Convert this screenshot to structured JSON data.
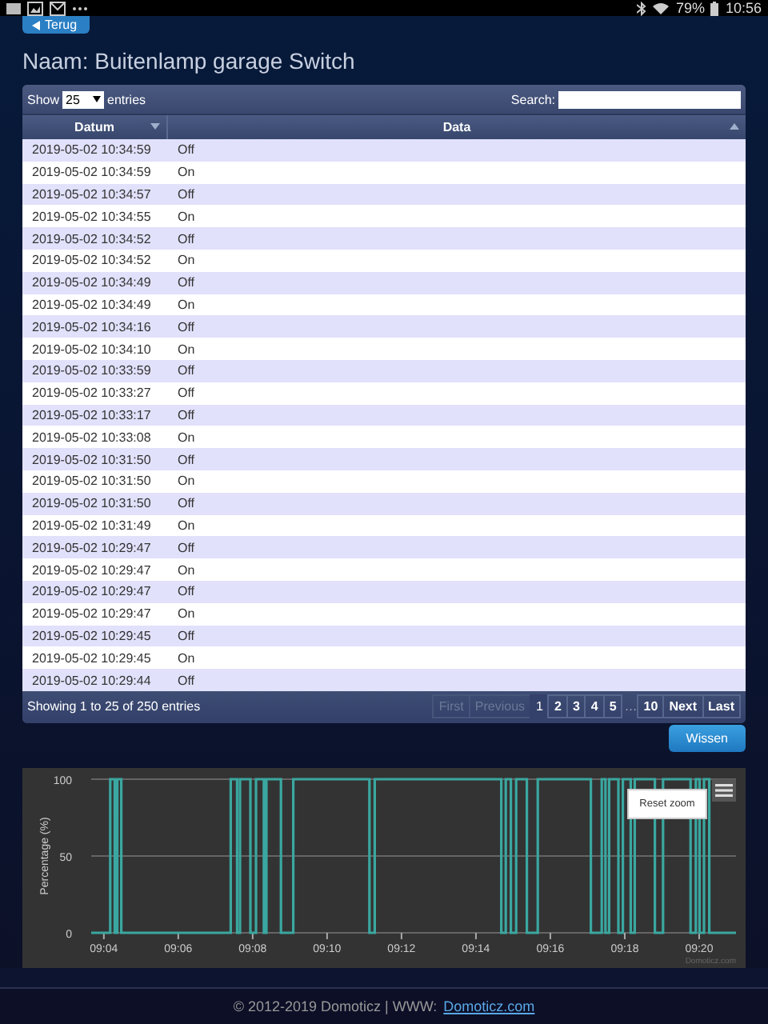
{
  "status_bar": {
    "battery": "79%",
    "time": "10:56"
  },
  "back_button": {
    "label": "Terug"
  },
  "title": "Naam: Buitenlamp garage Switch",
  "table": {
    "length_label_before": "Show",
    "length_value": "25",
    "length_label_after": "entries",
    "search_label": "Search:",
    "columns": [
      {
        "label": "Datum",
        "sort_ascending": false
      },
      {
        "label": "Data",
        "sort_ascending": true
      }
    ],
    "rows": [
      [
        "2019-05-02 10:34:59",
        "Off"
      ],
      [
        "2019-05-02 10:34:59",
        "On"
      ],
      [
        "2019-05-02 10:34:57",
        "Off"
      ],
      [
        "2019-05-02 10:34:55",
        "On"
      ],
      [
        "2019-05-02 10:34:52",
        "Off"
      ],
      [
        "2019-05-02 10:34:52",
        "On"
      ],
      [
        "2019-05-02 10:34:49",
        "Off"
      ],
      [
        "2019-05-02 10:34:49",
        "On"
      ],
      [
        "2019-05-02 10:34:16",
        "Off"
      ],
      [
        "2019-05-02 10:34:10",
        "On"
      ],
      [
        "2019-05-02 10:33:59",
        "Off"
      ],
      [
        "2019-05-02 10:33:27",
        "Off"
      ],
      [
        "2019-05-02 10:33:17",
        "Off"
      ],
      [
        "2019-05-02 10:33:08",
        "On"
      ],
      [
        "2019-05-02 10:31:50",
        "Off"
      ],
      [
        "2019-05-02 10:31:50",
        "On"
      ],
      [
        "2019-05-02 10:31:50",
        "Off"
      ],
      [
        "2019-05-02 10:31:49",
        "On"
      ],
      [
        "2019-05-02 10:29:47",
        "Off"
      ],
      [
        "2019-05-02 10:29:47",
        "On"
      ],
      [
        "2019-05-02 10:29:47",
        "Off"
      ],
      [
        "2019-05-02 10:29:47",
        "On"
      ],
      [
        "2019-05-02 10:29:45",
        "Off"
      ],
      [
        "2019-05-02 10:29:45",
        "On"
      ],
      [
        "2019-05-02 10:29:44",
        "Off"
      ]
    ],
    "info": "Showing 1 to 25 of 250 entries",
    "pagination": [
      {
        "label": "First",
        "kind": "button",
        "disabled": true,
        "selected": false
      },
      {
        "label": "Previous",
        "kind": "button",
        "disabled": true,
        "selected": false
      },
      {
        "label": "1",
        "kind": "number",
        "disabled": false,
        "selected": true
      },
      {
        "label": "2",
        "kind": "number",
        "disabled": false,
        "selected": false
      },
      {
        "label": "3",
        "kind": "number",
        "disabled": false,
        "selected": false
      },
      {
        "label": "4",
        "kind": "number",
        "disabled": false,
        "selected": false
      },
      {
        "label": "5",
        "kind": "number",
        "disabled": false,
        "selected": false
      },
      {
        "label": "…",
        "kind": "ellipsis"
      },
      {
        "label": "10",
        "kind": "number",
        "disabled": false,
        "selected": false
      },
      {
        "label": "Next",
        "kind": "button",
        "disabled": false,
        "selected": false
      },
      {
        "label": "Last",
        "kind": "button",
        "disabled": false,
        "selected": false
      }
    ]
  },
  "clear_button": {
    "label": "Wissen"
  },
  "chart": {
    "reset_zoom": "Reset zoom",
    "credits": "Domoticz.com",
    "chart_data": {
      "type": "line",
      "ylabel": "Percentage (%)",
      "xlim": [
        543.66,
        560.99
      ],
      "ylim": [
        0,
        100
      ],
      "yticks": [
        0,
        50,
        100
      ],
      "xticks": [
        {
          "value": 544,
          "label": "09:04"
        },
        {
          "value": 546,
          "label": "09:06"
        },
        {
          "value": 548,
          "label": "09:08"
        },
        {
          "value": 550,
          "label": "09:10"
        },
        {
          "value": 552,
          "label": "09:12"
        },
        {
          "value": 554,
          "label": "09:14"
        },
        {
          "value": 556,
          "label": "09:16"
        },
        {
          "value": 558,
          "label": "09:18"
        },
        {
          "value": 560,
          "label": "09:20"
        }
      ],
      "x": [
        543.66,
        544.17,
        544.17,
        544.29,
        544.29,
        544.36,
        544.36,
        544.47,
        544.47,
        547.41,
        547.41,
        547.58,
        547.58,
        547.66,
        547.66,
        547.94,
        547.94,
        548.09,
        548.09,
        548.3,
        548.3,
        548.37,
        548.37,
        548.76,
        548.76,
        549.09,
        549.09,
        551.14,
        551.14,
        551.28,
        551.28,
        554.68,
        554.68,
        554.8,
        554.8,
        554.94,
        554.94,
        555.08,
        555.08,
        555.37,
        555.37,
        555.66,
        555.66,
        557.09,
        557.09,
        557.38,
        557.38,
        557.48,
        557.48,
        557.58,
        557.58,
        557.83,
        557.83,
        557.95,
        557.95,
        558.16,
        558.16,
        558.27,
        558.27,
        558.81,
        558.81,
        559.03,
        559.03,
        559.77,
        559.77,
        559.91,
        559.91,
        560.01,
        560.01,
        560.13,
        560.13,
        560.27,
        560.27,
        560.99
      ],
      "series": [
        {
          "color": "#3aa7a0",
          "values": [
            0,
            0,
            100,
            100,
            0,
            0,
            100,
            100,
            0,
            0,
            100,
            100,
            0,
            0,
            100,
            100,
            0,
            0,
            100,
            100,
            0,
            0,
            100,
            100,
            0,
            0,
            100,
            100,
            0,
            0,
            100,
            100,
            0,
            0,
            100,
            100,
            0,
            0,
            100,
            100,
            0,
            0,
            100,
            100,
            0,
            0,
            100,
            100,
            0,
            0,
            100,
            100,
            0,
            0,
            100,
            100,
            0,
            0,
            100,
            100,
            0,
            0,
            100,
            100,
            0,
            0,
            100,
            100,
            0,
            0,
            100,
            100,
            0,
            0
          ]
        }
      ]
    }
  },
  "footer": {
    "copyright": "© 2012-2019 Domoticz | WWW:",
    "link": "Domoticz.com"
  }
}
